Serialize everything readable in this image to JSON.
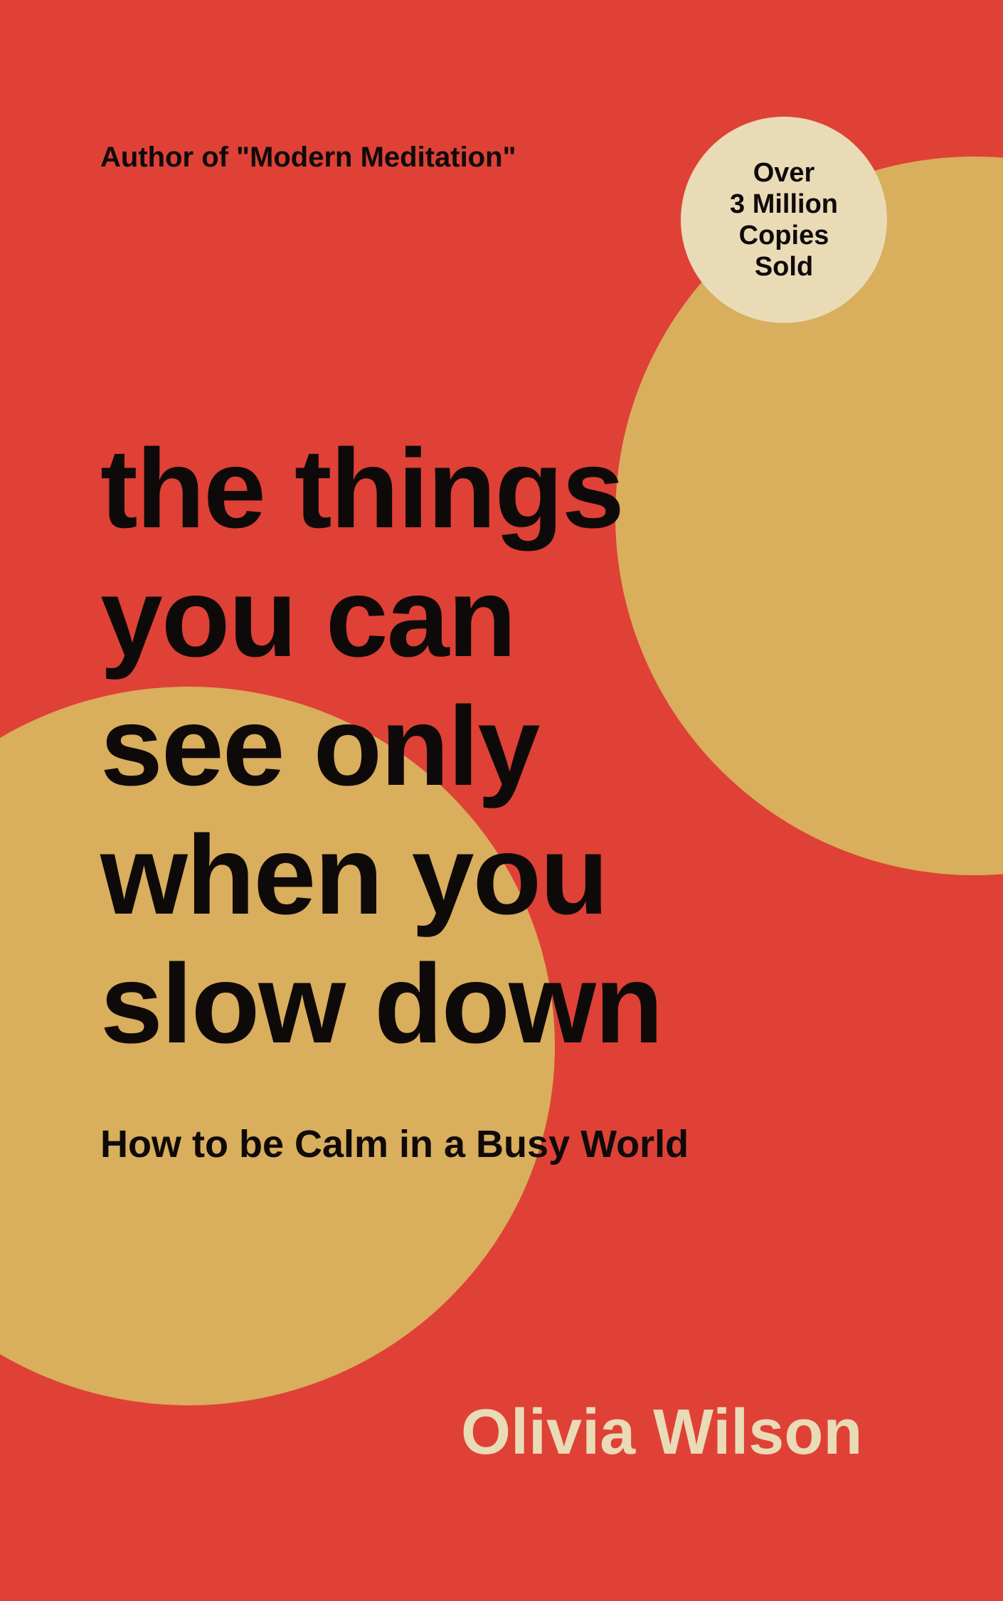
{
  "cover": {
    "author_credit": "Author of \"Modern Meditation\"",
    "badge_lines": [
      "Over",
      "3 Million",
      "Copies",
      "Sold"
    ],
    "title_lines": [
      "the things",
      "you can",
      "see only",
      "when you",
      "slow down"
    ],
    "subtitle": "How to be Calm in a Busy World",
    "author_name": "Olivia Wilson"
  },
  "colors": {
    "background": "#df4136",
    "circle": "#d9ae5c",
    "badge": "#eadbb7",
    "text_dark": "#0f0a0a",
    "author_name": "#eadbb7"
  }
}
